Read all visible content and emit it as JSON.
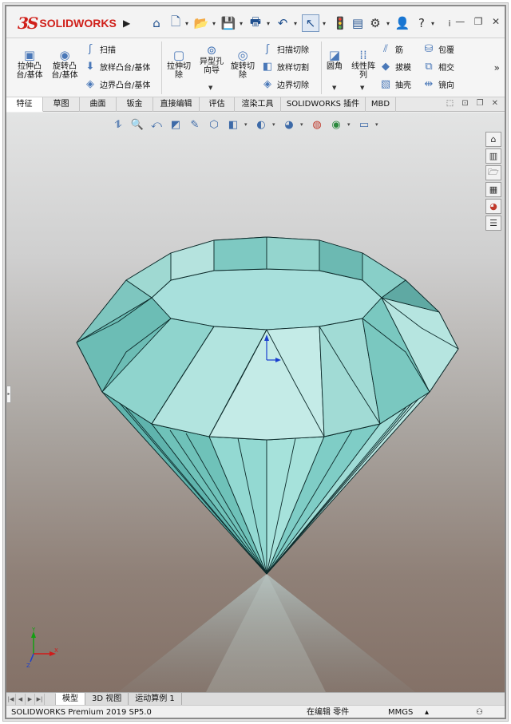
{
  "app": {
    "brand_prefix": "3S",
    "brand": "SOLIDWORKS",
    "colors": {
      "brand_red": "#d0201a",
      "accent_blue": "#4a78b8",
      "gem_fill": "#8fd8d2",
      "gem_edge": "#0d2b2b"
    }
  },
  "quick_access": {
    "icons": [
      "home-icon",
      "new-document-icon",
      "open-icon",
      "save-icon",
      "print-icon",
      "undo-icon",
      "select-icon",
      "rebuild-icon",
      "file-properties-icon",
      "options-icon",
      "user-icon",
      "help-icon",
      "search-icon",
      "minimize-icon",
      "restore-icon",
      "close-icon"
    ]
  },
  "ribbon": {
    "extrude_boss": "拉伸凸\n台/基体",
    "revolve_boss": "旋转凸\n台/基体",
    "sweep": "扫描",
    "loft_boss": "放样凸台/基体",
    "boundary_boss": "边界凸台/基体",
    "extrude_cut": "拉伸切\n除",
    "hole_wizard": "异型孔\n向导",
    "revolve_cut": "旋转切\n除",
    "sweep_cut": "扫描切除",
    "loft_cut": "放样切割",
    "boundary_cut": "边界切除",
    "fillet": "圆角",
    "linear_pattern": "线性阵\n列",
    "rib": "筋",
    "draft": "拔模",
    "shell": "抽壳",
    "wrap": "包覆",
    "intersect": "相交",
    "mirror": "镜向"
  },
  "tabs": [
    "特征",
    "草图",
    "曲面",
    "钣金",
    "直接编辑",
    "评估",
    "渲染工具",
    "SOLIDWORKS 插件",
    "MBD"
  ],
  "active_tab": "特征",
  "bottom_tabs": [
    "模型",
    "3D 视图",
    "运动算例 1"
  ],
  "active_bottom_tab": "模型",
  "status": {
    "product": "SOLIDWORKS Premium 2019 SP5.0",
    "mode": "在编辑 零件",
    "units": "MMGS"
  }
}
